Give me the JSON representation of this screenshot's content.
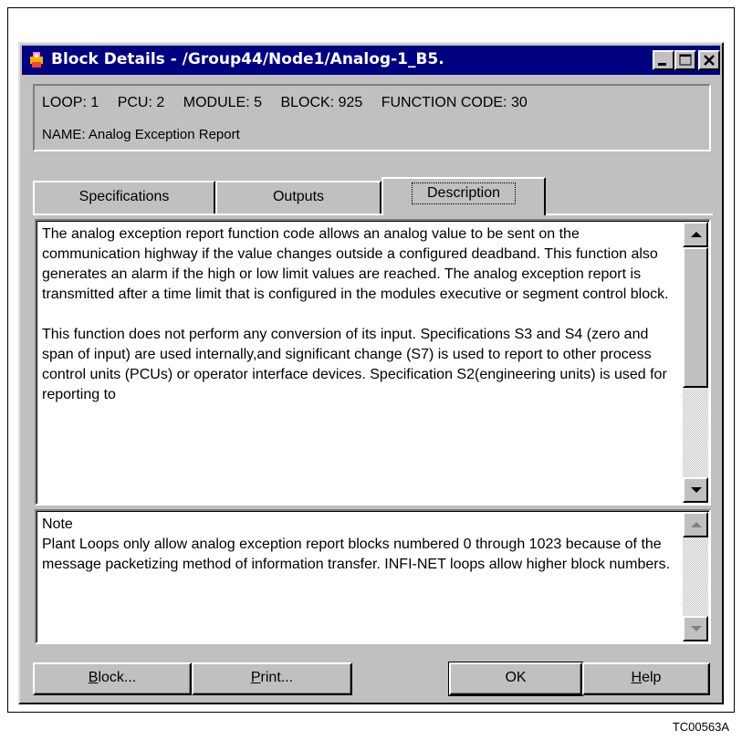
{
  "window": {
    "title": "Block Details - /Group44/Node1/Analog-1_B5."
  },
  "info": {
    "loop": "LOOP: 1",
    "pcu": "PCU: 2",
    "module": "MODULE: 5",
    "block": "BLOCK: 925",
    "function_code": "FUNCTION CODE: 30",
    "name": "NAME: Analog Exception Report"
  },
  "tabs": [
    {
      "label": "Specifications",
      "selected": false
    },
    {
      "label": "Outputs",
      "selected": false
    },
    {
      "label": "Description",
      "selected": true
    }
  ],
  "description": {
    "paragraph1": "The analog exception report function code allows an analog value to be sent on the communication highway if the value changes outside a configured deadband. This function also generates an alarm if the high or low limit values are reached. The analog exception report is transmitted after a time limit that is configured in the modules executive or segment control block.",
    "paragraph2": "This function does not perform any conversion of its input. Specifications S3 and S4 (zero and span of input) are used internally,and significant change (S7) is used to report to other process control units (PCUs) or operator interface devices. Specification S2(engineering units) is used for reporting to"
  },
  "note": {
    "heading": "Note",
    "text": "Plant Loops only allow analog exception report blocks numbered 0 through 1023 because of the message packetizing method of information transfer. INFI-NET loops allow higher block numbers."
  },
  "buttons": {
    "block": {
      "accel": "B",
      "rest": "lock..."
    },
    "print": {
      "accel": "P",
      "rest": "rint..."
    },
    "ok": {
      "label": "OK"
    },
    "help": {
      "accel": "H",
      "rest": "elp"
    }
  },
  "figure_id": "TC00563A",
  "colors": {
    "titlebar": "#000080",
    "face": "#c0c0c0",
    "pane": "#ffffff"
  }
}
